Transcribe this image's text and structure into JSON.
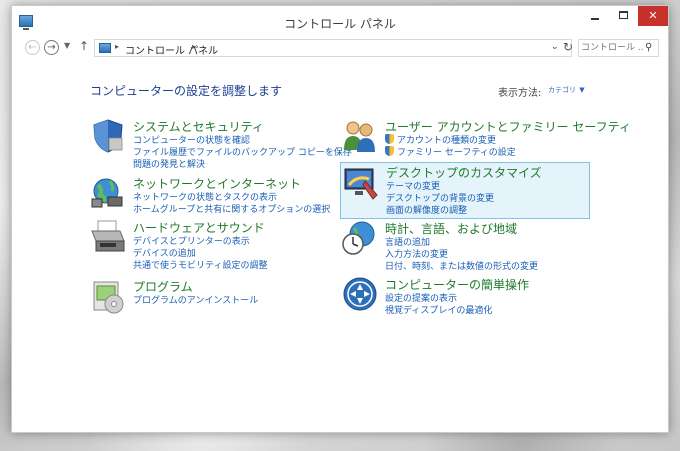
{
  "window": {
    "title": "コントロール パネル"
  },
  "nav": {
    "address_text": "コントロール パネル",
    "search_placeholder": "コントロール ..."
  },
  "main": {
    "title": "コンピューターの設定を調整します",
    "view_by_label": "表示方法:",
    "view_by_value": "カテゴリ"
  },
  "categories": [
    {
      "id": "system-security",
      "title": "システムとセキュリティ",
      "icon": "shield-icon",
      "links": [
        "コンピューターの状態を確認",
        "ファイル履歴でファイルのバックアップ コピーを保存",
        "問題の発見と解決"
      ]
    },
    {
      "id": "network",
      "title": "ネットワークとインターネット",
      "icon": "network-globe-icon",
      "links": [
        "ネットワークの状態とタスクの表示",
        "ホームグループと共有に関するオプションの選択"
      ]
    },
    {
      "id": "hardware",
      "title": "ハードウェアとサウンド",
      "icon": "printer-icon",
      "links": [
        "デバイスとプリンターの表示",
        "デバイスの追加",
        "共通で使うモビリティ設定の調整"
      ]
    },
    {
      "id": "programs",
      "title": "プログラム",
      "icon": "programs-icon",
      "links": [
        "プログラムのアンインストール"
      ]
    },
    {
      "id": "user-accounts",
      "title": "ユーザー アカウントとファミリー セーフティ",
      "icon": "users-icon",
      "links": [
        "アカウントの種類の変更",
        "ファミリー セーフティの設定"
      ]
    },
    {
      "id": "personalize",
      "title": "デスクトップのカスタマイズ",
      "icon": "monitor-paint-icon",
      "links": [
        "テーマの変更",
        "デスクトップの背景の変更",
        "画面の解像度の調整"
      ]
    },
    {
      "id": "clock-region",
      "title": "時計、言語、および地域",
      "icon": "clock-globe-icon",
      "links": [
        "言語の追加",
        "入力方法の変更",
        "日付、時刻、または数値の形式の変更"
      ]
    },
    {
      "id": "ease-access",
      "title": "コンピューターの簡単操作",
      "icon": "ease-of-access-icon",
      "links": [
        "設定の提案の表示",
        "視覚ディスプレイの最適化"
      ]
    }
  ]
}
